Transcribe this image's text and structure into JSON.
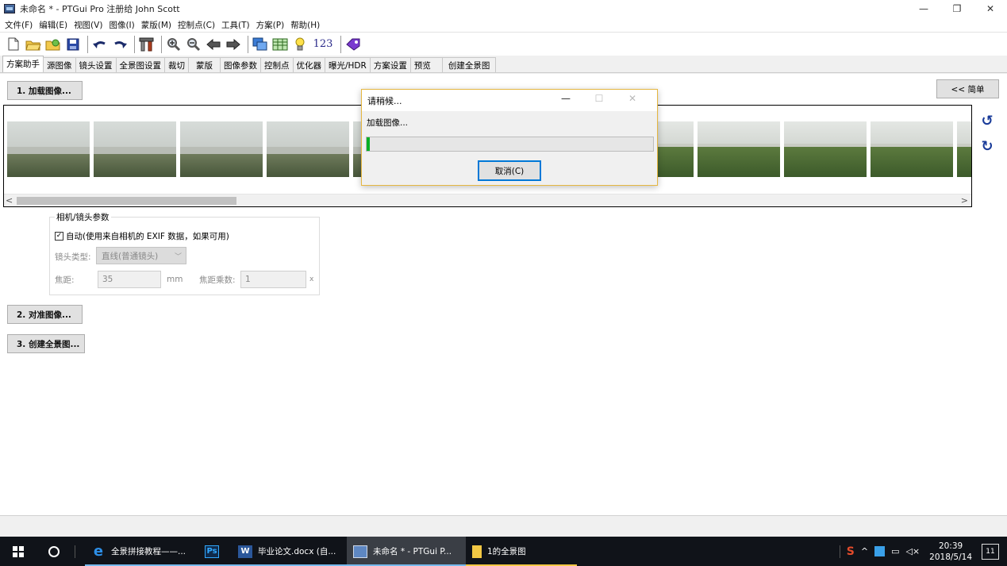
{
  "window": {
    "title": "未命名 * - PTGui Pro 注册给 John Scott",
    "minimize": "—",
    "maximize": "❐",
    "close": "✕"
  },
  "menu": [
    "文件(F)",
    "编辑(E)",
    "视图(V)",
    "图像(I)",
    "蒙版(M)",
    "控制点(C)",
    "工具(T)",
    "方案(P)",
    "帮助(H)"
  ],
  "toolbar": {
    "text_button": "123"
  },
  "tabs": [
    "方案助手",
    "源图像",
    "镜头设置",
    "全景图设置",
    "裁切",
    "蒙版",
    "图像参数",
    "控制点",
    "优化器",
    "曝光/HDR",
    "方案设置",
    "预览",
    "创建全景图"
  ],
  "buttons": {
    "load_images": "1. 加载图像...",
    "simple": "<< 简单",
    "align_images": "2. 对准图像...",
    "create_panorama": "3. 创建全景图..."
  },
  "camera_group": {
    "legend": "相机/镜头参数",
    "auto_label": "自动(使用来自相机的 EXIF 数据，如果可用)",
    "auto_checked": true,
    "lens_type_label": "镜头类型:",
    "lens_type_value": "直线(普通镜头)",
    "focal_label": "焦距:",
    "focal_value": "35",
    "focal_unit": "mm",
    "multiplier_label": "焦距乘数:",
    "multiplier_value": "1",
    "multiplier_unit": "x"
  },
  "dialog": {
    "title": "请稍候...",
    "message": "加载图像...",
    "progress": 0.01,
    "cancel": "取消(C)"
  },
  "taskbar": {
    "items": [
      {
        "label": "全景拼接教程——...",
        "icon": "edge-icon"
      },
      {
        "label": "",
        "icon": "photoshop-icon"
      },
      {
        "label": "毕业论文.docx (自...",
        "icon": "word-icon"
      },
      {
        "label": "未命名 * - PTGui P...",
        "icon": "ptgui-icon"
      },
      {
        "label": "1的全景图",
        "icon": "folder-icon"
      }
    ],
    "time": "20:39",
    "date": "2018/5/14",
    "notification_count": "11"
  }
}
